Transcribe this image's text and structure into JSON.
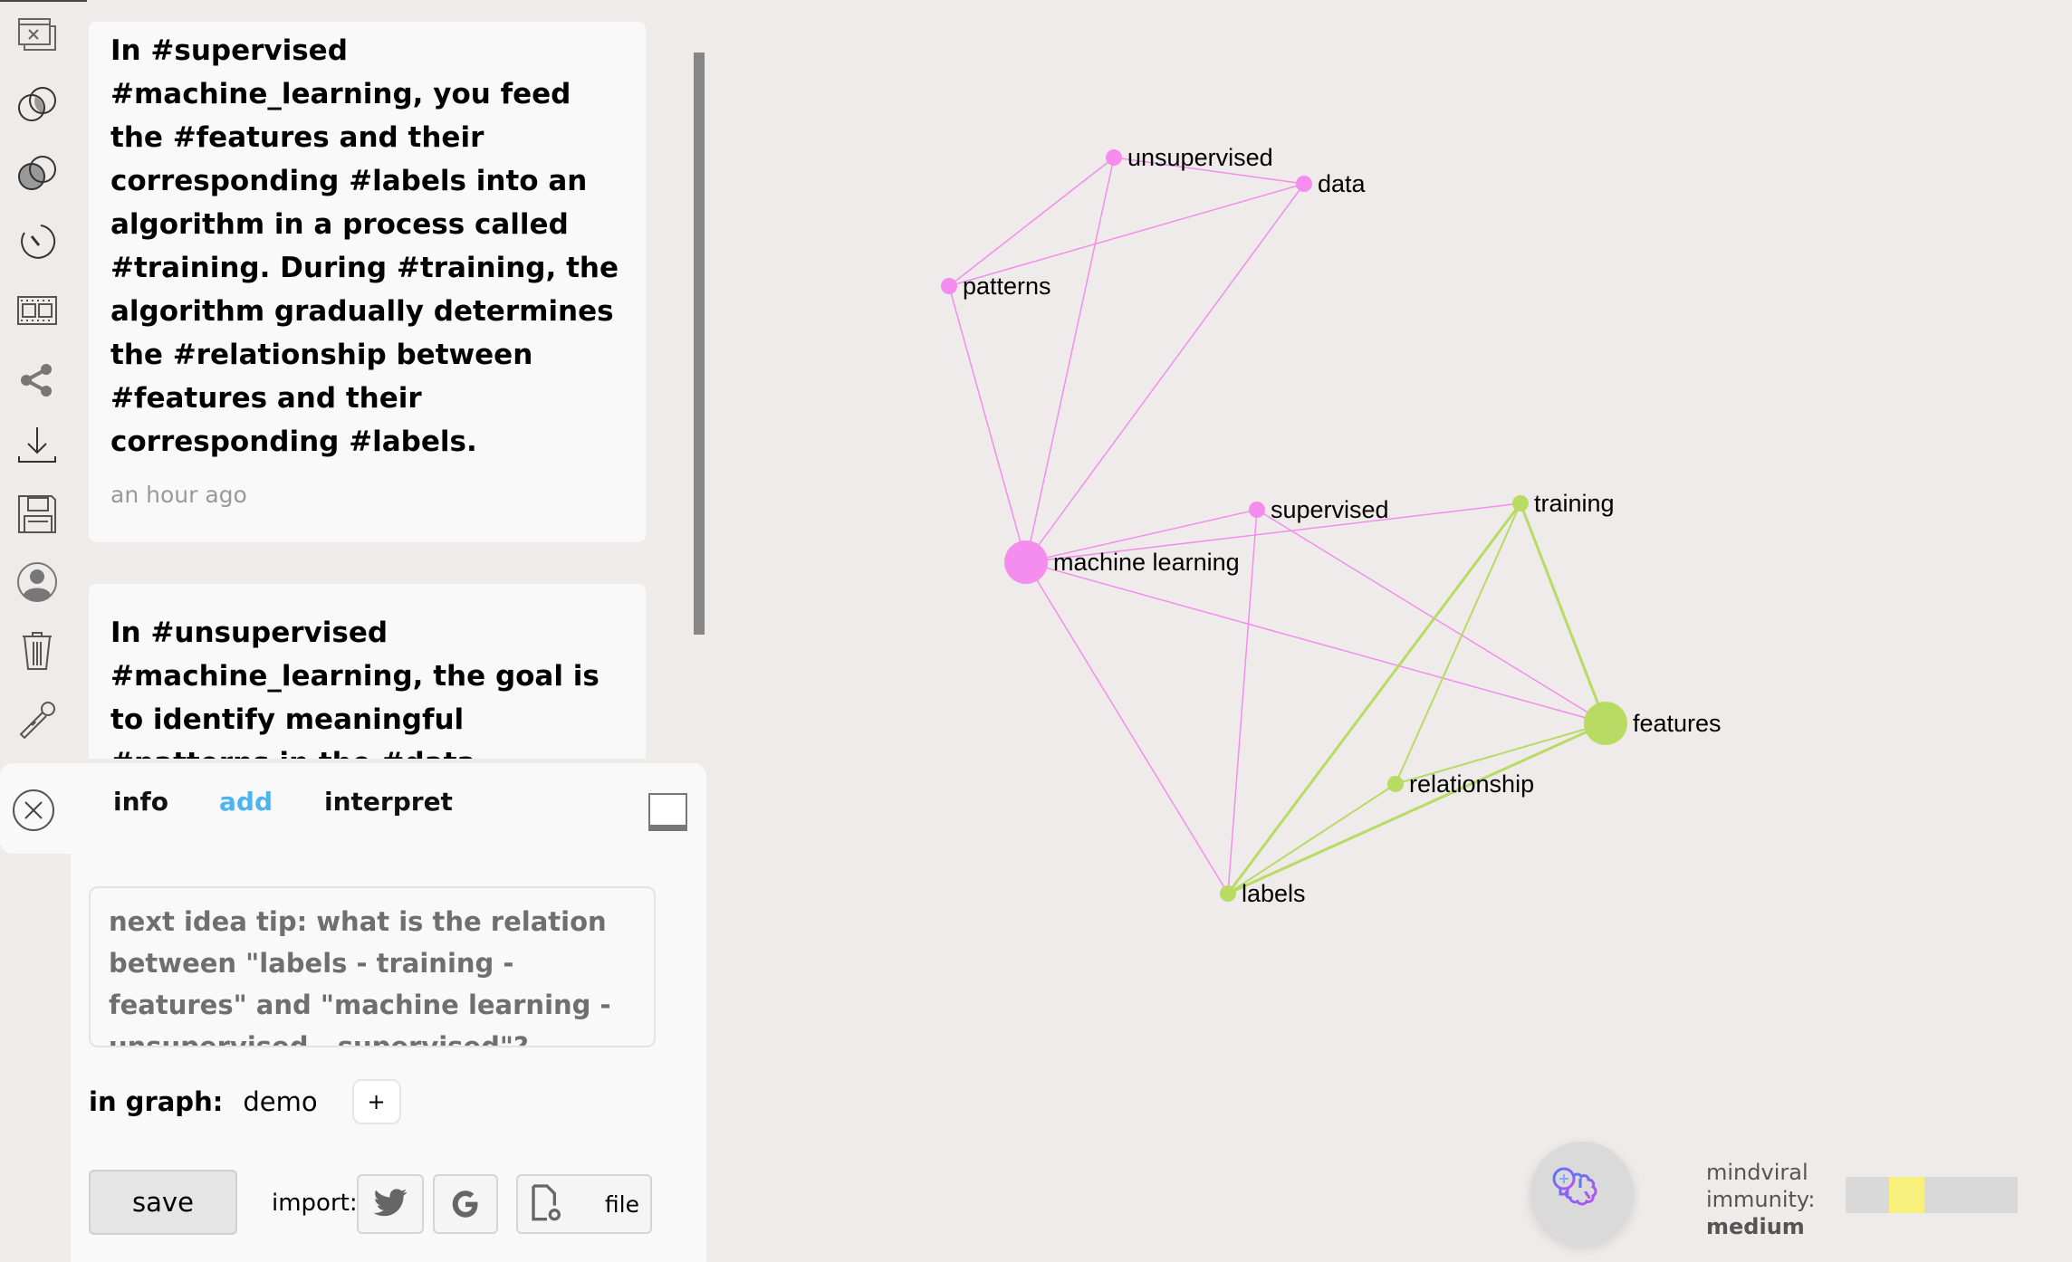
{
  "rail": {
    "items": [
      {
        "name": "close-windows-icon",
        "label": "close windows"
      },
      {
        "name": "intersect-icon",
        "label": "intersection"
      },
      {
        "name": "difference-icon",
        "label": "difference"
      },
      {
        "name": "timer-icon",
        "label": "timer"
      },
      {
        "name": "film-icon",
        "label": "film"
      },
      {
        "name": "share-icon",
        "label": "share"
      },
      {
        "name": "download-icon",
        "label": "download"
      },
      {
        "name": "save-icon",
        "label": "save"
      },
      {
        "name": "user-icon",
        "label": "account"
      },
      {
        "name": "trash-icon",
        "label": "delete"
      },
      {
        "name": "microphone-icon",
        "label": "voice"
      }
    ]
  },
  "feed": {
    "cards": [
      {
        "text": "In #supervised #machine_learning, you feed the #features and their corresponding #labels into an algorithm in a process called #training. During #training, the algorithm gradually determines the #relationship between #features and their corresponding #labels.",
        "time": "an hour ago"
      },
      {
        "text": "In #unsupervised #machine_learning, the goal is to identify meaningful #patterns in the #data",
        "time": ""
      }
    ]
  },
  "panel": {
    "tabs": [
      {
        "label": "info",
        "active": false
      },
      {
        "label": "add",
        "active": true
      },
      {
        "label": "interpret",
        "active": false
      }
    ],
    "tip_placeholder": "next idea tip: what is the relation between \"labels - training - features\" and \"machine learning - unsupervised - supervised\"?",
    "in_graph_label": "in graph:",
    "graph_name": "demo",
    "add_graph_label": "+",
    "save_label": "save",
    "import_label": "import:",
    "import_file_label": "file"
  },
  "graph": {
    "colors": {
      "pink": "#f48ded",
      "green": "#b7db63"
    },
    "nodes": [
      {
        "id": "unsupervised",
        "label": "unsupervised",
        "cluster": "pink",
        "size": "small"
      },
      {
        "id": "data",
        "label": "data",
        "cluster": "pink",
        "size": "small"
      },
      {
        "id": "patterns",
        "label": "patterns",
        "cluster": "pink",
        "size": "small"
      },
      {
        "id": "supervised",
        "label": "supervised",
        "cluster": "pink",
        "size": "small"
      },
      {
        "id": "machine_learning",
        "label": "machine learning",
        "cluster": "pink",
        "size": "large"
      },
      {
        "id": "training",
        "label": "training",
        "cluster": "green",
        "size": "small"
      },
      {
        "id": "features",
        "label": "features",
        "cluster": "green",
        "size": "large"
      },
      {
        "id": "relationship",
        "label": "relationship",
        "cluster": "green",
        "size": "small"
      },
      {
        "id": "labels",
        "label": "labels",
        "cluster": "green",
        "size": "small"
      }
    ],
    "edges": [
      {
        "source": "unsupervised",
        "target": "data",
        "cluster": "pink",
        "weight": 1
      },
      {
        "source": "unsupervised",
        "target": "patterns",
        "cluster": "pink",
        "weight": 1
      },
      {
        "source": "patterns",
        "target": "data",
        "cluster": "pink",
        "weight": 1
      },
      {
        "source": "machine_learning",
        "target": "patterns",
        "cluster": "pink",
        "weight": 1
      },
      {
        "source": "machine_learning",
        "target": "unsupervised",
        "cluster": "pink",
        "weight": 1
      },
      {
        "source": "machine_learning",
        "target": "data",
        "cluster": "pink",
        "weight": 1
      },
      {
        "source": "machine_learning",
        "target": "supervised",
        "cluster": "pink",
        "weight": 1
      },
      {
        "source": "machine_learning",
        "target": "training",
        "cluster": "pink",
        "weight": 1
      },
      {
        "source": "machine_learning",
        "target": "features",
        "cluster": "pink",
        "weight": 1
      },
      {
        "source": "machine_learning",
        "target": "labels",
        "cluster": "pink",
        "weight": 1
      },
      {
        "source": "supervised",
        "target": "features",
        "cluster": "pink",
        "weight": 1
      },
      {
        "source": "supervised",
        "target": "labels",
        "cluster": "pink",
        "weight": 1
      },
      {
        "source": "training",
        "target": "features",
        "cluster": "green",
        "weight": 2
      },
      {
        "source": "training",
        "target": "labels",
        "cluster": "green",
        "weight": 2
      },
      {
        "source": "training",
        "target": "relationship",
        "cluster": "green",
        "weight": 1
      },
      {
        "source": "features",
        "target": "relationship",
        "cluster": "green",
        "weight": 1
      },
      {
        "source": "features",
        "target": "labels",
        "cluster": "green",
        "weight": 2
      },
      {
        "source": "relationship",
        "target": "labels",
        "cluster": "green",
        "weight": 1
      }
    ]
  },
  "immunity": {
    "label_line1": "mindviral",
    "label_line2": "immunity:",
    "level": "medium",
    "fill_start": 0.25,
    "fill_fraction": 0.21,
    "fill_color": "#f8f07d"
  }
}
